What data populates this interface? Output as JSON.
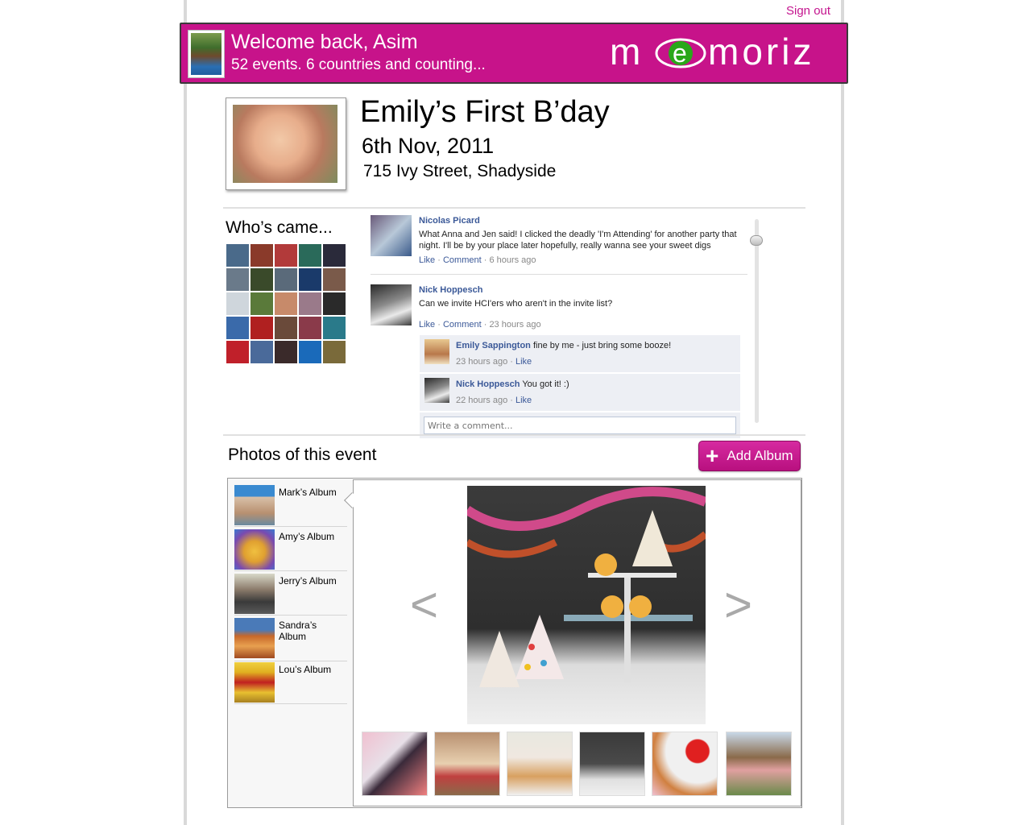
{
  "header": {
    "signout_label": "Sign out",
    "welcome": "Welcome back, Asim",
    "tagline": "52 events. 6 countries and counting...",
    "logo_text": "memoriz",
    "brand_color": "#c7138a"
  },
  "event": {
    "title": "Emily’s First B’day",
    "date": "6th Nov, 2011",
    "address": "715 Ivy Street, Shadyside"
  },
  "attendees": {
    "title": "Who’s came..."
  },
  "feed": {
    "posts": [
      {
        "name": "Nicolas Picard",
        "text": "What Anna and Jen said! I clicked the deadly 'I'm Attending' for another party that night. I'll be by your place later hopefully, really wanna see your sweet digs",
        "like": "Like",
        "comment": "Comment",
        "time": "6 hours ago"
      },
      {
        "name": "Nick Hoppesch",
        "text": "Can we invite HCI'ers who aren't in the invite list?",
        "like": "Like",
        "comment": "Comment",
        "time": "23 hours ago"
      }
    ],
    "replies": [
      {
        "name": "Emily Sappington",
        "text": "fine by me - just bring some booze!",
        "time": "23 hours ago",
        "like": "Like"
      },
      {
        "name": "Nick Hoppesch",
        "text": "You got it! :)",
        "time": "22 hours ago",
        "like": "Like"
      }
    ],
    "write_placeholder": "Write a comment..."
  },
  "photos": {
    "title": "Photos of this event",
    "add_album_label": "Add Album",
    "albums": [
      {
        "name": "Mark’s Album"
      },
      {
        "name": "Amy’s Album"
      },
      {
        "name": "Jerry’s Album"
      },
      {
        "name": "Sandra’s Album"
      },
      {
        "name": "Lou’s Album"
      }
    ],
    "prev_label": "<",
    "next_label": ">"
  }
}
